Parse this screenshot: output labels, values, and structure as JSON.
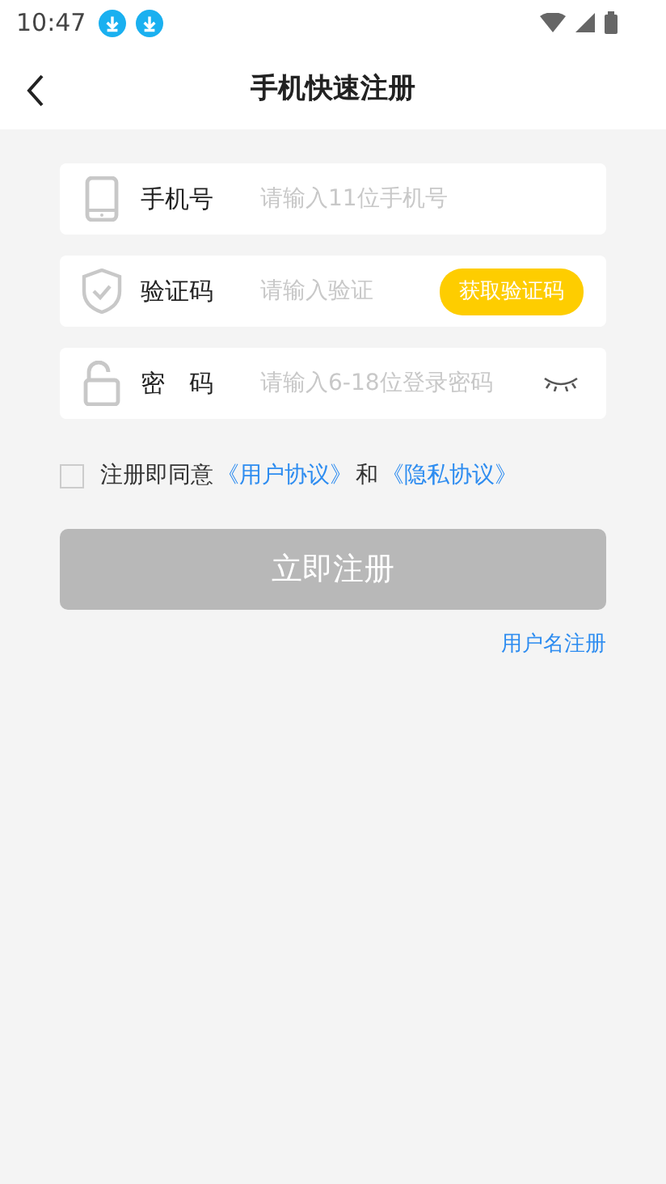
{
  "status_bar": {
    "time": "10:47"
  },
  "header": {
    "title": "手机快速注册"
  },
  "fields": [
    {
      "kind": "phone",
      "label": "手机号",
      "placeholder": "请输入11位手机号"
    },
    {
      "kind": "code",
      "label": "验证码",
      "placeholder": "请输入验证",
      "button": "获取验证码"
    },
    {
      "kind": "password",
      "label": "密　码",
      "placeholder": "请输入6-18位登录密码"
    }
  ],
  "agreement": {
    "checked": false,
    "prefix": "注册即同意",
    "link1": "《用户协议》",
    "middle": "和",
    "link2": "《隐私协议》"
  },
  "register_button": {
    "label": "立即注册",
    "disabled": true
  },
  "username_link": "用户名注册"
}
